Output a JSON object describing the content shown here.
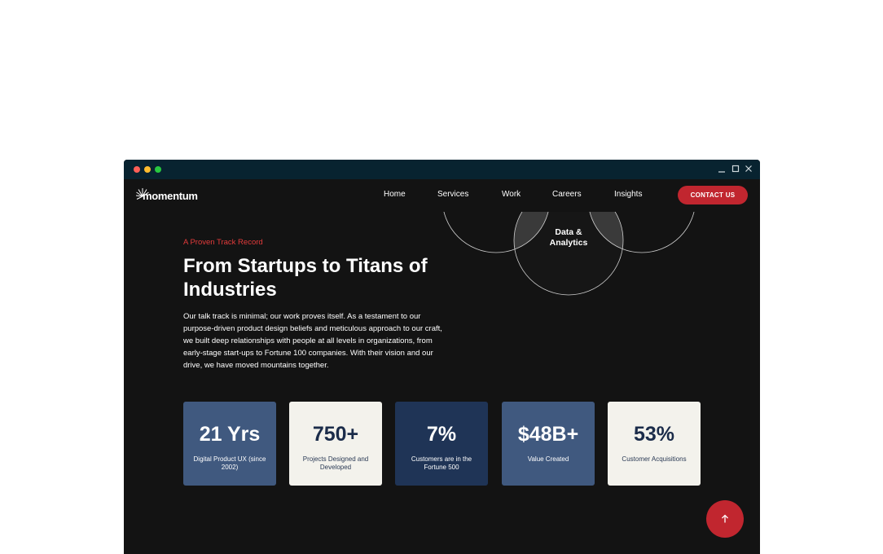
{
  "window": {
    "controls": [
      "minimize-icon",
      "maximize-icon",
      "close-icon"
    ]
  },
  "nav": {
    "logo": "momentum",
    "links": [
      "Home",
      "Services",
      "Work",
      "Careers",
      "Insights"
    ],
    "contact": "CONTACT US"
  },
  "diagram": {
    "label_line1": "Data &",
    "label_line2": "Analytics"
  },
  "hero": {
    "eyebrow": "A Proven Track Record",
    "headline": "From Startups to Titans of Industries",
    "body": "Our talk track is minimal; our work proves itself. As a testament to our purpose-driven product design beliefs and meticulous approach to our craft, we built deep relationships with people at all levels in organizations, from early-stage start-ups to Fortune 100 companies. With their vision and our drive, we have moved mountains together."
  },
  "stats": [
    {
      "value": "21 Yrs",
      "label": "Digital Product UX (since 2002)"
    },
    {
      "value": "750+",
      "label": "Projects Designed and Developed"
    },
    {
      "value": "7%",
      "label": "Customers are in the Fortune 500"
    },
    {
      "value": "$48B+",
      "label": "Value Created"
    },
    {
      "value": "53%",
      "label": "Customer Acquisitions"
    }
  ],
  "colors": {
    "accent": "#c1262f",
    "background": "#131313",
    "titlebar": "#082330",
    "card_blue": "#40597f",
    "card_navy": "#1f3456",
    "card_cream": "#f3f2ec"
  },
  "icons": {
    "scroll_top": "arrow-up-icon"
  }
}
